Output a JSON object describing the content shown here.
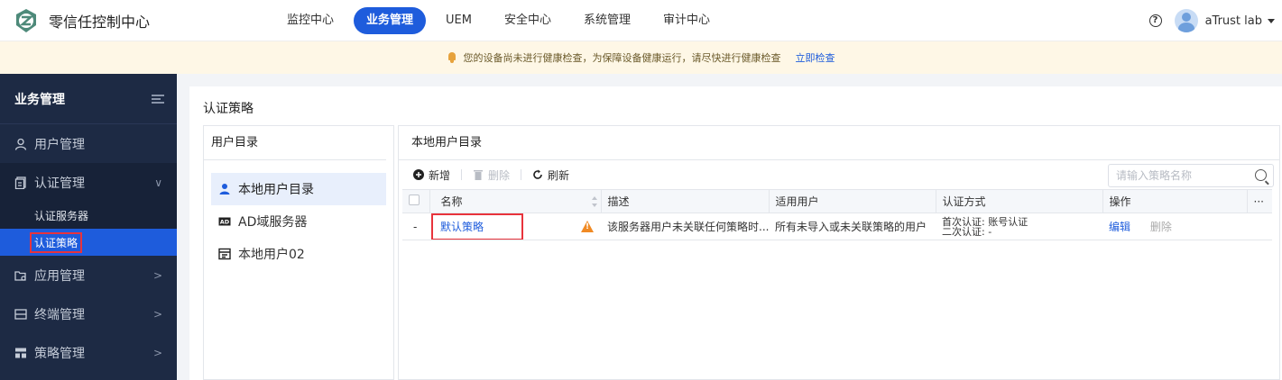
{
  "app": {
    "title": "零信任控制中心"
  },
  "nav": {
    "items": [
      {
        "label": "监控中心",
        "active": false
      },
      {
        "label": "业务管理",
        "active": true
      },
      {
        "label": "UEM",
        "active": false
      },
      {
        "label": "安全中心",
        "active": false
      },
      {
        "label": "系统管理",
        "active": false
      },
      {
        "label": "审计中心",
        "active": false
      }
    ]
  },
  "header": {
    "help_glyph": "?",
    "user_name": "aTrust lab"
  },
  "notice": {
    "text": "您的设备尚未进行健康检查，为保障设备健康运行，请尽快进行健康检查",
    "link": "立即检查"
  },
  "sidebar": {
    "title": "业务管理",
    "items": [
      {
        "label": "用户管理"
      },
      {
        "label": "认证管理",
        "expanded": true,
        "chevron": "∨",
        "children": [
          {
            "label": "认证服务器"
          },
          {
            "label": "认证策略",
            "active": true
          }
        ]
      },
      {
        "label": "应用管理",
        "chevron": ">"
      },
      {
        "label": "终端管理",
        "chevron": ">"
      },
      {
        "label": "策略管理",
        "chevron": ">"
      }
    ]
  },
  "page": {
    "title": "认证策略"
  },
  "directory": {
    "title": "用户目录",
    "items": [
      {
        "label": "本地用户目录",
        "active": true
      },
      {
        "label": "AD域服务器",
        "badge": "AD"
      },
      {
        "label": "本地用户02"
      }
    ]
  },
  "content": {
    "title": "本地用户目录",
    "toolbar": {
      "add": "新增",
      "delete": "删除",
      "refresh": "刷新"
    },
    "search": {
      "placeholder": "请输入策略名称"
    },
    "table": {
      "headers": {
        "name": "名称",
        "desc": "描述",
        "users": "适用用户",
        "auth": "认证方式",
        "ops": "操作",
        "more": "···"
      },
      "rows": [
        {
          "index": "-",
          "name": "默认策略",
          "desc": "该服务器用户未关联任何策略时...",
          "users": "所有未导入或未关联策略的用户",
          "auth_first": "首次认证:  账号认证",
          "auth_second": "二次认证:  -",
          "edit": "编辑",
          "delete": "删除"
        }
      ]
    }
  },
  "colors": {
    "accent": "#1e5cdc",
    "sidebar_bg": "#1d2a44",
    "highlight_border": "#e8333c",
    "warning": "#f08a24"
  }
}
